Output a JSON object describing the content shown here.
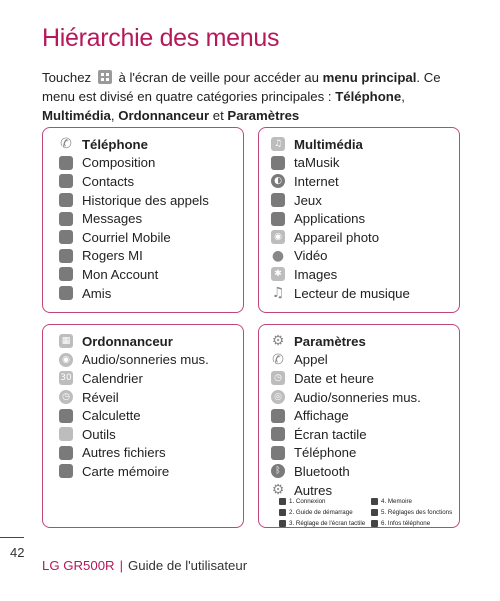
{
  "page": {
    "title": "Hiérarchie des menus",
    "intro": {
      "part1": "Touchez",
      "key_icon": "menu-grid-icon",
      "part2": "à l'écran de veille pour accéder au",
      "bold1": "menu principal",
      "part3": ". Ce menu est divisé en quatre catégories principales :",
      "bold2": "Téléphone",
      "sep1": ",",
      "bold3": "Multimédia",
      "sep2": ",",
      "bold4": "Ordonnanceur",
      "part4": "et",
      "bold5": "Paramètres"
    },
    "page_number": "42",
    "footer": {
      "brand": "LG GR500R",
      "separator": "|",
      "label": "Guide de l'utilisateur"
    }
  },
  "sections": {
    "telephone": {
      "header": {
        "label": "Téléphone",
        "icon": "phone-handset-icon"
      },
      "items": [
        {
          "label": "Composition",
          "icon": "dialer-icon"
        },
        {
          "label": "Contacts",
          "icon": "contacts-icon"
        },
        {
          "label": "Historique des appels",
          "icon": "call-history-icon"
        },
        {
          "label": "Messages",
          "icon": "envelope-icon"
        },
        {
          "label": "Courriel Mobile",
          "icon": "email-icon"
        },
        {
          "label": "Rogers MI",
          "icon": "messenger-icon"
        },
        {
          "label": "Mon Account",
          "icon": "account-icon"
        },
        {
          "label": "Amis",
          "icon": "friends-icon"
        }
      ]
    },
    "multimedia": {
      "header": {
        "label": "Multimédia",
        "icon": "multimedia-icon"
      },
      "items": [
        {
          "label": "taMusik",
          "icon": "music-store-icon"
        },
        {
          "label": "Internet",
          "icon": "globe-icon"
        },
        {
          "label": "Jeux",
          "icon": "gamepad-icon"
        },
        {
          "label": "Applications",
          "icon": "folder-icon"
        },
        {
          "label": "Appareil photo",
          "icon": "camera-icon"
        },
        {
          "label": "Vidéo",
          "icon": "video-icon"
        },
        {
          "label": "Images",
          "icon": "image-icon"
        },
        {
          "label": "Lecteur de musique",
          "icon": "music-note-icon"
        }
      ]
    },
    "organiser": {
      "header": {
        "label": "Ordonnanceur",
        "icon": "organiser-icon"
      },
      "items": [
        {
          "label": "Audio/sonneries mus.",
          "icon": "speaker-icon"
        },
        {
          "label": "Calendrier",
          "icon": "calendar-icon",
          "glyph": "30"
        },
        {
          "label": "Réveil",
          "icon": "alarm-clock-icon"
        },
        {
          "label": "Calculette",
          "icon": "calculator-icon"
        },
        {
          "label": "Outils",
          "icon": "toolbox-icon"
        },
        {
          "label": "Autres fichiers",
          "icon": "files-folder-icon"
        },
        {
          "label": "Carte mémoire",
          "icon": "memory-card-icon"
        }
      ]
    },
    "settings": {
      "header": {
        "label": "Paramètres",
        "icon": "settings-gear-icon"
      },
      "items": [
        {
          "label": "Appel",
          "icon": "call-settings-icon"
        },
        {
          "label": "Date et heure",
          "icon": "date-time-icon"
        },
        {
          "label": "Audio/sonneries mus.",
          "icon": "sound-profile-icon"
        },
        {
          "label": "Affichage",
          "icon": "display-icon"
        },
        {
          "label": "Écran tactile",
          "icon": "touchscreen-icon"
        },
        {
          "label": "Téléphone",
          "icon": "phone-settings-icon"
        },
        {
          "label": "Bluetooth",
          "icon": "bluetooth-icon"
        },
        {
          "label": "Autres",
          "icon": "other-settings-icon"
        }
      ],
      "sub_items": [
        {
          "label": "1. Connexion",
          "icon": "connection-icon"
        },
        {
          "label": "4. Memoire",
          "icon": "memory-icon"
        },
        {
          "label": "2. Guide de démarrage",
          "icon": "start-guide-icon"
        },
        {
          "label": "5. Réglages des fonctions",
          "icon": "function-settings-icon"
        },
        {
          "label": "3. Réglage de l'écran tactile",
          "icon": "touch-calibration-icon"
        },
        {
          "label": "6. Infos téléphone",
          "icon": "phone-info-icon"
        }
      ]
    }
  },
  "colors": {
    "accent": "#b5195b",
    "box_border": "#c0467a",
    "text": "#222222"
  }
}
